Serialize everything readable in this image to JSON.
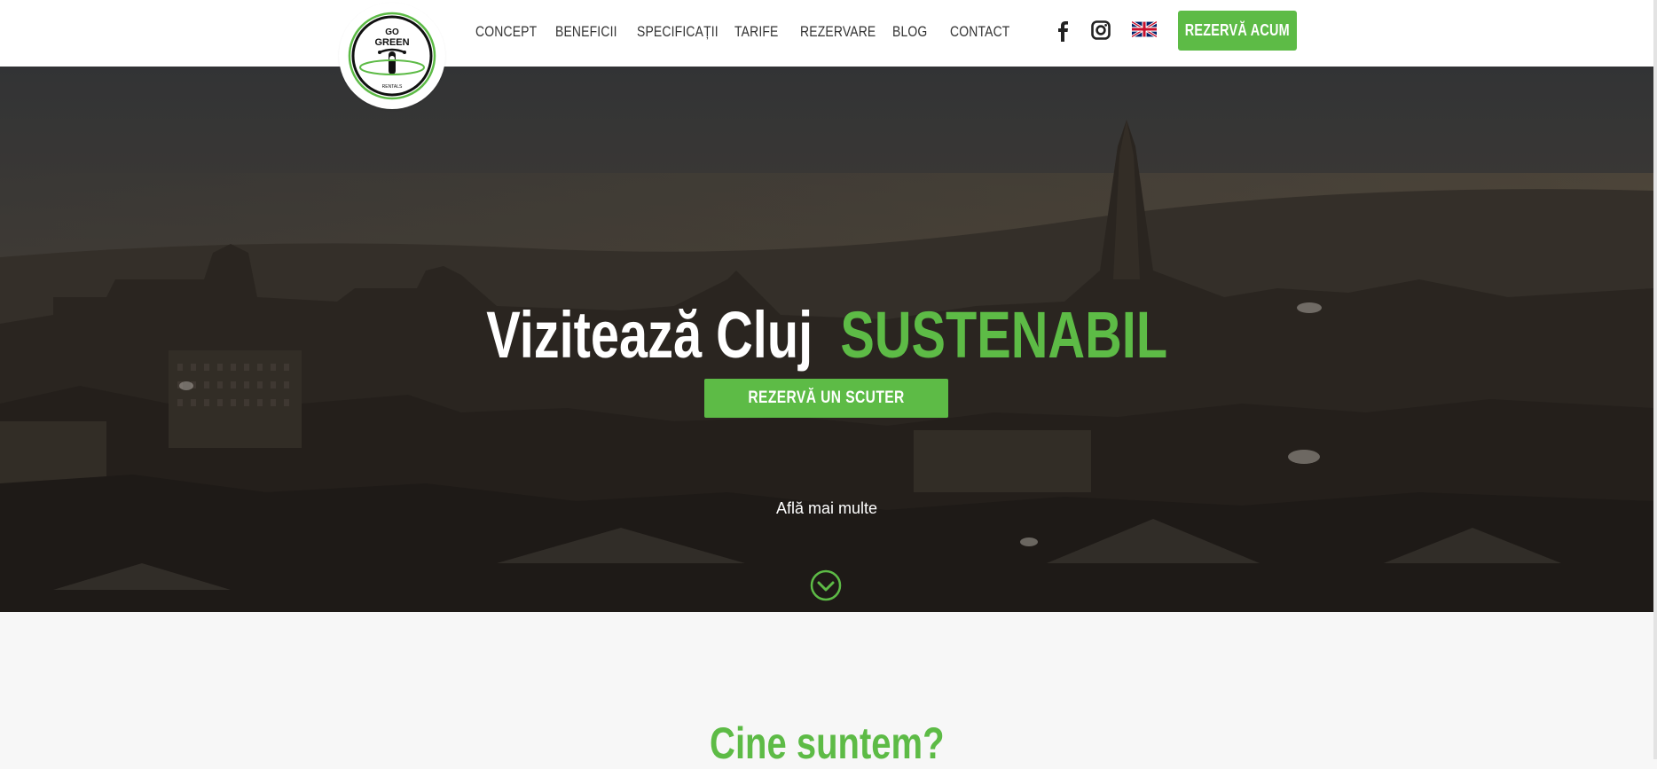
{
  "brand": {
    "logo_text_top": "GO",
    "logo_text_mid": "GREEN",
    "logo_text_bottom": "RENTALS"
  },
  "nav": {
    "items": [
      {
        "label": "CONCEPT"
      },
      {
        "label": "BENEFICII"
      },
      {
        "label": "SPECIFICAȚII"
      },
      {
        "label": "TARIFE"
      },
      {
        "label": "REZERVARE"
      },
      {
        "label": "BLOG"
      },
      {
        "label": "CONTACT"
      }
    ],
    "social_icons": [
      "facebook-icon",
      "instagram-icon",
      "uk-flag-icon"
    ],
    "cta_label": "REZERVĂ ACUM"
  },
  "hero": {
    "title_white": "Vizitează Cluj",
    "title_green": "SUSTENABIL",
    "button_label": "REZERVĂ UN SCUTER",
    "learn_more": "Află mai multe"
  },
  "section": {
    "title": "Cine suntem?"
  },
  "colors": {
    "accent": "#5dbb46",
    "header_bg": "#ffffff",
    "section_bg": "#f7f7f7",
    "nav_text": "#333333"
  }
}
